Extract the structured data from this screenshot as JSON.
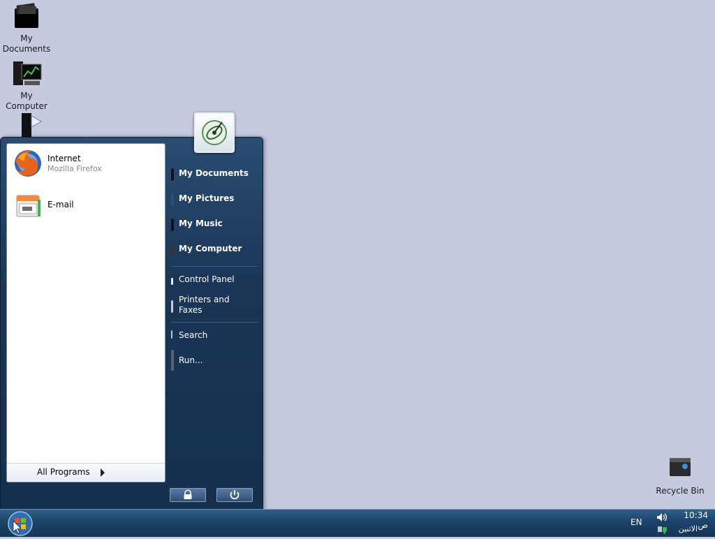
{
  "desktop": {
    "icons": [
      {
        "label": "My\nDocuments"
      },
      {
        "label": "My Computer"
      },
      {
        "label": ""
      },
      {
        "label": "Recycle Bin"
      }
    ]
  },
  "start_menu": {
    "pinned": [
      {
        "title": "Internet",
        "subtitle": "Mozilla Firefox",
        "icon": "firefox-icon"
      },
      {
        "title": "E-mail",
        "subtitle": "",
        "icon": "email-icon"
      }
    ],
    "all_programs": "All Programs",
    "right_links": [
      {
        "label": "My Documents"
      },
      {
        "label": "My Pictures"
      },
      {
        "label": "My Music"
      },
      {
        "label": "My Computer"
      },
      {
        "label": "Control Panel"
      },
      {
        "label": "Printers and Faxes"
      },
      {
        "label": "Search"
      },
      {
        "label": "Run..."
      }
    ]
  },
  "taskbar": {
    "language": "EN",
    "clock_time": "10:34 ص",
    "clock_day": "الاثنين"
  },
  "colors": {
    "desktop_bg": "#c5cadf",
    "menu_dark": "#15304f",
    "taskbar": "#1c4268"
  }
}
